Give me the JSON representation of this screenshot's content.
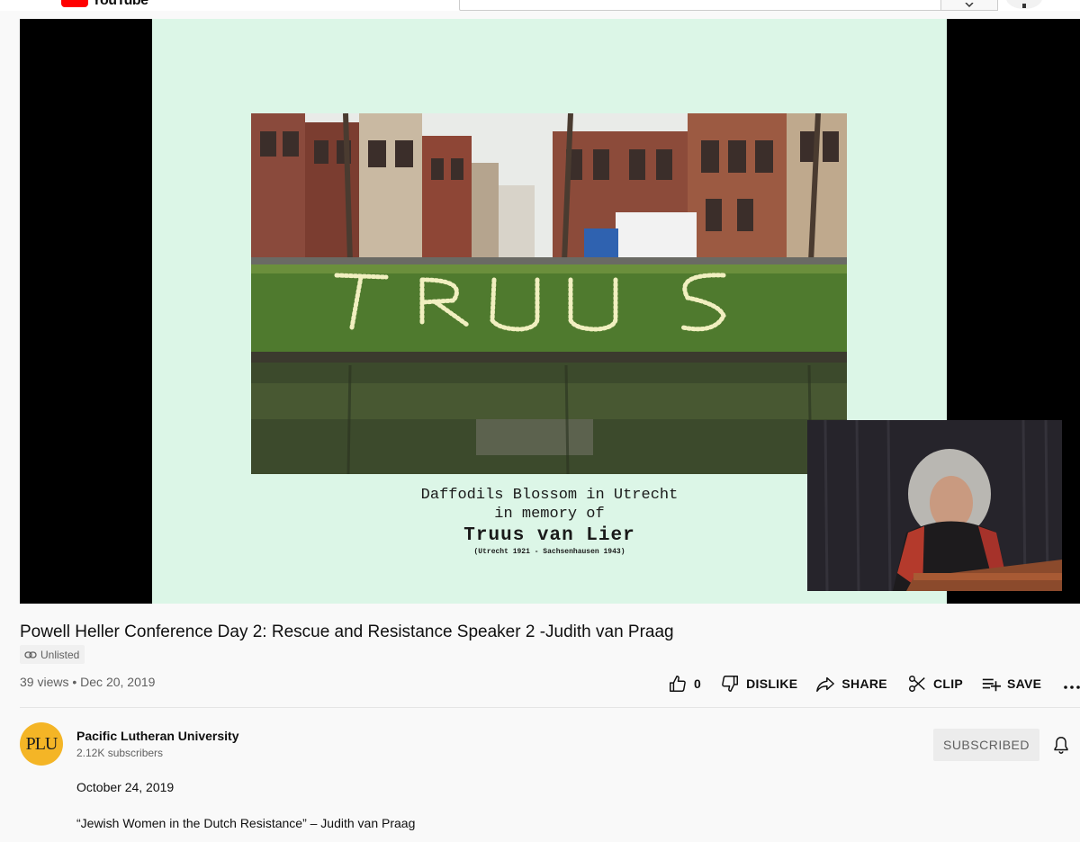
{
  "header": {
    "logo_text": "YouTube",
    "search_placeholder": ""
  },
  "player": {
    "slide": {
      "caption_line1": "Daffodils Blossom in Utrecht",
      "caption_line2": "in memory of",
      "caption_name": "Truus van Lier",
      "caption_dates": "(Utrecht 1921 - Sachsenhausen 1943)"
    }
  },
  "video": {
    "title": "Powell Heller Conference Day 2: Rescue and Resistance Speaker 2 -Judith van Praag",
    "badge": "Unlisted",
    "views": "39 views",
    "date": "Dec 20, 2019",
    "separator": "•"
  },
  "actions": {
    "like_count": "0",
    "dislike_label": "DISLIKE",
    "share_label": "SHARE",
    "clip_label": "CLIP",
    "save_label": "SAVE"
  },
  "channel": {
    "name": "Pacific Lutheran University",
    "subscribers": "2.12K subscribers",
    "avatar_text": "PLU",
    "subscribe_label": "SUBSCRIBED"
  },
  "description": {
    "date": "October 24, 2019",
    "line": "“Jewish Women in the Dutch Resistance” – Judith van Praag"
  },
  "colors": {
    "slide_bg": "#dcf6e7",
    "avatar_bg": "#f4b526",
    "brand_red": "#ff0000"
  }
}
